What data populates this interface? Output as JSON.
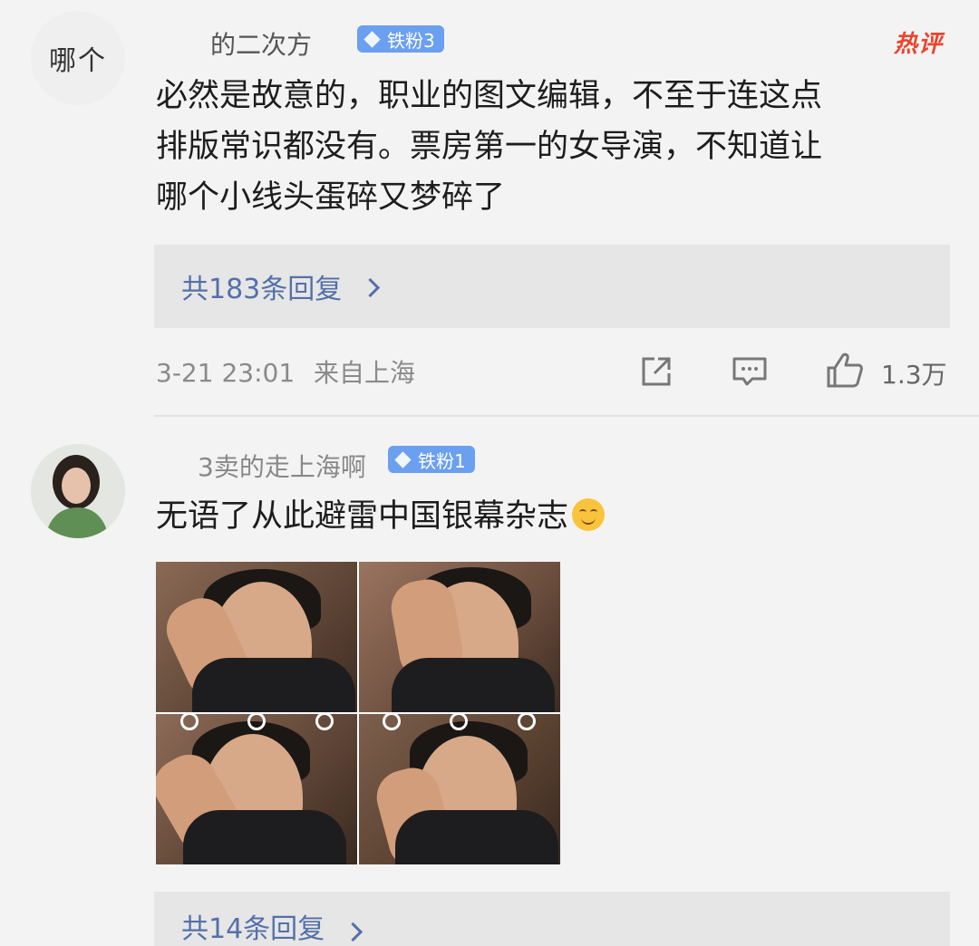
{
  "comments": [
    {
      "avatar_text": "哪个",
      "username": "的二次方",
      "badge": "铁粉3",
      "hot_label": "热评",
      "body": [
        "必然是故意的，职业的图文编辑，不至于连这点",
        "排版常识都没有。票房第一的女导演，不知道让",
        "哪个小线头蛋碎又梦碎了"
      ],
      "replies_label": "共183条回复",
      "timestamp": "3-21 23:01",
      "location": "来自上海",
      "like_count": "1.3万"
    },
    {
      "username": "3卖的走上海啊",
      "badge": "铁粉1",
      "body": "无语了从此避雷中国银幕杂志",
      "emoji": "smiling-emoji",
      "replies_label": "共14条回复"
    }
  ],
  "colors": {
    "badge": "#6b9ff0",
    "hot": "#e8452f",
    "link": "#5470a8",
    "meta": "#8a8a8a"
  }
}
